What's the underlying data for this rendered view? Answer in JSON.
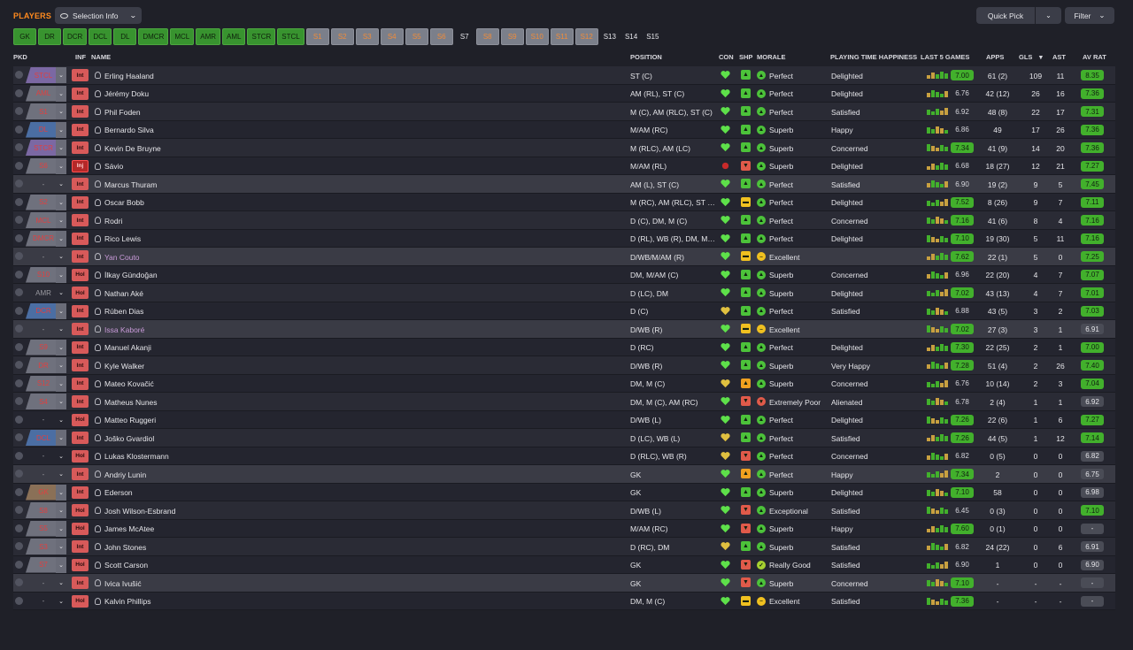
{
  "header": {
    "title": "PLAYERS",
    "selection_info": "Selection Info",
    "quick_pick": "Quick Pick",
    "filter": "Filter"
  },
  "positions": [
    {
      "label": "GK",
      "state": "g"
    },
    {
      "label": "DR",
      "state": "g"
    },
    {
      "label": "DCR",
      "state": "g"
    },
    {
      "label": "DCL",
      "state": "g"
    },
    {
      "label": "DL",
      "state": "g"
    },
    {
      "label": "DMCR",
      "state": "g"
    },
    {
      "label": "MCL",
      "state": "g"
    },
    {
      "label": "AMR",
      "state": "g"
    },
    {
      "label": "AML",
      "state": "g"
    },
    {
      "label": "STCR",
      "state": "g"
    },
    {
      "label": "STCL",
      "state": "g"
    },
    {
      "label": "S1",
      "state": "x"
    },
    {
      "label": "S2",
      "state": "x"
    },
    {
      "label": "S3",
      "state": "x"
    },
    {
      "label": "S4",
      "state": "x"
    },
    {
      "label": "S5",
      "state": "x"
    },
    {
      "label": "S6",
      "state": "x"
    },
    {
      "label": "S7",
      "state": "n"
    },
    {
      "label": "S8",
      "state": "x"
    },
    {
      "label": "S9",
      "state": "x"
    },
    {
      "label": "S10",
      "state": "x"
    },
    {
      "label": "S11",
      "state": "x"
    },
    {
      "label": "S12",
      "state": "x"
    },
    {
      "label": "S13",
      "state": "n"
    },
    {
      "label": "S14",
      "state": "n"
    },
    {
      "label": "S15",
      "state": "n"
    }
  ],
  "columns": {
    "pkd": "PKD",
    "inf": "INF",
    "name": "NAME",
    "position": "POSITION",
    "con": "CON",
    "shp": "SHP",
    "morale": "MORALE",
    "pth": "PLAYING TIME HAPPINESS",
    "last5": "LAST 5 GAMES",
    "apps": "APPS",
    "gls": "GLS",
    "ast": "AST",
    "avrat": "AV RAT"
  },
  "colors": {
    "accent": "#ff8a1e",
    "green": "#42b02c",
    "red": "#d85a5a",
    "background": "#1f2028"
  },
  "players": [
    {
      "pkd": "STCL",
      "pc": "pu",
      "inf": "Int",
      "name": "Erling Haaland",
      "position": "ST (C)",
      "shp": "up",
      "morale": "Perfect",
      "pth": "Delighted",
      "l5": "7.00",
      "l5hi": true,
      "apps": "61 (2)",
      "gls": "109",
      "ast": "11",
      "av": "8.35",
      "avhi": true
    },
    {
      "pkd": "AML",
      "pc": "g",
      "inf": "Int",
      "name": "Jérémy Doku",
      "position": "AM (RL), ST (C)",
      "shp": "up",
      "morale": "Perfect",
      "pth": "Delighted",
      "l5": "6.76",
      "l5hi": false,
      "apps": "42 (12)",
      "gls": "26",
      "ast": "16",
      "av": "7.36",
      "avhi": true
    },
    {
      "pkd": "S1",
      "pc": "g",
      "inf": "Int",
      "name": "Phil Foden",
      "position": "M (C), AM (RLC), ST (C)",
      "shp": "up",
      "morale": "Perfect",
      "pth": "Satisfied",
      "l5": "6.92",
      "l5hi": false,
      "apps": "48 (8)",
      "gls": "22",
      "ast": "17",
      "av": "7.31",
      "avhi": true
    },
    {
      "pkd": "DL",
      "pc": "b",
      "inf": "Int",
      "name": "Bernardo Silva",
      "position": "M/AM (RC)",
      "shp": "up",
      "morale": "Superb",
      "pth": "Happy",
      "l5": "6.86",
      "l5hi": false,
      "apps": "49",
      "gls": "17",
      "ast": "26",
      "av": "7.36",
      "avhi": true
    },
    {
      "pkd": "STCR",
      "pc": "pu",
      "inf": "Int",
      "name": "Kevin De Bruyne",
      "position": "M (RLC), AM (LC)",
      "shp": "up",
      "morale": "Superb",
      "pth": "Concerned",
      "l5": "7.34",
      "l5hi": true,
      "apps": "41 (9)",
      "gls": "14",
      "ast": "20",
      "av": "7.36",
      "avhi": true
    },
    {
      "pkd": "S6",
      "pc": "g",
      "inf": "Inj",
      "name": "Sávio",
      "position": "M/AM (RL)",
      "shp": "down",
      "morale": "Superb",
      "pth": "Delighted",
      "l5": "6.68",
      "l5hi": false,
      "apps": "18 (27)",
      "gls": "12",
      "ast": "21",
      "av": "7.27",
      "avhi": true
    },
    {
      "pkd": "-",
      "pc": "d",
      "inf": "Int",
      "name": "Marcus Thuram",
      "position": "AM (L), ST (C)",
      "shp": "up",
      "morale": "Perfect",
      "pth": "Satisfied",
      "l5": "6.90",
      "l5hi": false,
      "apps": "19 (2)",
      "gls": "9",
      "ast": "5",
      "av": "7.45",
      "avhi": true,
      "hl": true
    },
    {
      "pkd": "S2",
      "pc": "g",
      "inf": "Int",
      "name": "Oscar Bobb",
      "position": "M (RC), AM (RLC), ST (C)",
      "shp": "flat",
      "morale": "Perfect",
      "pth": "Delighted",
      "l5": "7.52",
      "l5hi": true,
      "apps": "8 (26)",
      "gls": "9",
      "ast": "7",
      "av": "7.11",
      "avhi": true
    },
    {
      "pkd": "MCL",
      "pc": "g",
      "inf": "Int",
      "name": "Rodri",
      "position": "D (C), DM, M (C)",
      "shp": "up",
      "morale": "Perfect",
      "pth": "Concerned",
      "l5": "7.16",
      "l5hi": true,
      "apps": "41 (6)",
      "gls": "8",
      "ast": "4",
      "av": "7.16",
      "avhi": true
    },
    {
      "pkd": "DMCR",
      "pc": "g",
      "inf": "Int",
      "name": "Rico Lewis",
      "position": "D (RL), WB (R), DM, M (C)",
      "shp": "up",
      "morale": "Perfect",
      "pth": "Delighted",
      "l5": "7.10",
      "l5hi": true,
      "apps": "19 (30)",
      "gls": "5",
      "ast": "11",
      "av": "7.16",
      "avhi": true
    },
    {
      "pkd": "-",
      "pc": "d",
      "inf": "Int",
      "name": "Yan Couto",
      "loan": true,
      "position": "D/WB/M/AM (R)",
      "shp": "flat",
      "morale": "Excellent",
      "pth": "",
      "l5": "7.62",
      "l5hi": true,
      "apps": "22 (1)",
      "gls": "5",
      "ast": "0",
      "av": "7.25",
      "avhi": true,
      "hl": true
    },
    {
      "pkd": "S10",
      "pc": "g",
      "inf": "Hol",
      "name": "İlkay Gündoğan",
      "position": "DM, M/AM (C)",
      "shp": "up",
      "morale": "Superb",
      "pth": "Concerned",
      "l5": "6.96",
      "l5hi": false,
      "apps": "22 (20)",
      "gls": "4",
      "ast": "7",
      "av": "7.07",
      "avhi": true
    },
    {
      "pkd": "AMR",
      "pc": "d",
      "inf": "Hol",
      "name": "Nathan Aké",
      "position": "D (LC), DM",
      "shp": "up",
      "morale": "Superb",
      "pth": "Delighted",
      "l5": "7.02",
      "l5hi": true,
      "apps": "43 (13)",
      "gls": "4",
      "ast": "7",
      "av": "7.01",
      "avhi": true
    },
    {
      "pkd": "DCR",
      "pc": "b",
      "inf": "Int",
      "name": "Rúben Dias",
      "position": "D (C)",
      "shp": "up",
      "morale": "Perfect",
      "pth": "Satisfied",
      "l5": "6.88",
      "l5hi": false,
      "apps": "43 (5)",
      "gls": "3",
      "ast": "2",
      "av": "7.03",
      "avhi": true
    },
    {
      "pkd": "-",
      "pc": "d",
      "inf": "Int",
      "name": "Issa Kaboré",
      "loan": true,
      "position": "D/WB (R)",
      "shp": "flat",
      "morale": "Excellent",
      "pth": "",
      "l5": "7.02",
      "l5hi": true,
      "apps": "27 (3)",
      "gls": "3",
      "ast": "1",
      "av": "6.91",
      "avhi": false,
      "hl": true
    },
    {
      "pkd": "S9",
      "pc": "g",
      "inf": "Int",
      "name": "Manuel Akanji",
      "position": "D (RC)",
      "shp": "up",
      "morale": "Perfect",
      "pth": "Delighted",
      "l5": "7.30",
      "l5hi": true,
      "apps": "22 (25)",
      "gls": "2",
      "ast": "1",
      "av": "7.00",
      "avhi": true
    },
    {
      "pkd": "DR",
      "pc": "g",
      "inf": "Int",
      "name": "Kyle Walker",
      "position": "D/WB (R)",
      "shp": "up",
      "morale": "Superb",
      "pth": "Very Happy",
      "l5": "7.28",
      "l5hi": true,
      "apps": "51 (4)",
      "gls": "2",
      "ast": "26",
      "av": "7.40",
      "avhi": true
    },
    {
      "pkd": "S12",
      "pc": "g",
      "inf": "Int",
      "name": "Mateo Kovačić",
      "position": "DM, M (C)",
      "shp": "upo",
      "morale": "Superb",
      "pth": "Concerned",
      "l5": "6.76",
      "l5hi": false,
      "apps": "10 (14)",
      "gls": "2",
      "ast": "3",
      "av": "7.04",
      "avhi": true
    },
    {
      "pkd": "S4",
      "pc": "g",
      "inf": "Int",
      "name": "Matheus Nunes",
      "position": "DM, M (C), AM (RC)",
      "shp": "down",
      "morale": "Extremely Poor",
      "pth": "Alienated",
      "l5": "6.78",
      "l5hi": false,
      "apps": "2 (4)",
      "gls": "1",
      "ast": "1",
      "av": "6.92",
      "avhi": false
    },
    {
      "pkd": "-",
      "pc": "d",
      "inf": "Hol",
      "name": "Matteo Ruggeri",
      "position": "D/WB (L)",
      "shp": "up",
      "morale": "Perfect",
      "pth": "Delighted",
      "l5": "7.26",
      "l5hi": true,
      "apps": "22 (6)",
      "gls": "1",
      "ast": "6",
      "av": "7.27",
      "avhi": true
    },
    {
      "pkd": "DCL",
      "pc": "b",
      "inf": "Int",
      "name": "Joško Gvardiol",
      "position": "D (LC), WB (L)",
      "shp": "up",
      "morale": "Perfect",
      "pth": "Satisfied",
      "l5": "7.26",
      "l5hi": true,
      "apps": "44 (5)",
      "gls": "1",
      "ast": "12",
      "av": "7.14",
      "avhi": true
    },
    {
      "pkd": "-",
      "pc": "d",
      "inf": "Hol",
      "name": "Lukas Klostermann",
      "position": "D (RLC), WB (R)",
      "shp": "down",
      "morale": "Perfect",
      "pth": "Concerned",
      "l5": "6.82",
      "l5hi": false,
      "apps": "0 (5)",
      "gls": "0",
      "ast": "0",
      "av": "6.82",
      "avhi": false
    },
    {
      "pkd": "-",
      "pc": "d",
      "inf": "Int",
      "name": "Andriy Lunin",
      "position": "GK",
      "shp": "upo",
      "morale": "Perfect",
      "pth": "Happy",
      "l5": "7.34",
      "l5hi": true,
      "apps": "2",
      "gls": "0",
      "ast": "0",
      "av": "6.75",
      "avhi": false,
      "hl": true
    },
    {
      "pkd": "GK",
      "pc": "br",
      "inf": "Int",
      "name": "Ederson",
      "position": "GK",
      "shp": "up",
      "morale": "Superb",
      "pth": "Delighted",
      "l5": "7.10",
      "l5hi": true,
      "apps": "58",
      "gls": "0",
      "ast": "0",
      "av": "6.98",
      "avhi": false
    },
    {
      "pkd": "S8",
      "pc": "g",
      "inf": "Hol",
      "name": "Josh Wilson-Esbrand",
      "position": "D/WB (L)",
      "shp": "down",
      "morale": "Exceptional",
      "pth": "Satisfied",
      "l5": "6.45",
      "l5hi": false,
      "apps": "0 (3)",
      "gls": "0",
      "ast": "0",
      "av": "7.10",
      "avhi": true
    },
    {
      "pkd": "S5",
      "pc": "g",
      "inf": "Hol",
      "name": "James McAtee",
      "position": "M/AM (RC)",
      "shp": "down",
      "morale": "Superb",
      "pth": "Happy",
      "l5": "7.60",
      "l5hi": true,
      "apps": "0 (1)",
      "gls": "0",
      "ast": "0",
      "av": "-",
      "avhi": false
    },
    {
      "pkd": "S3",
      "pc": "g",
      "inf": "Int",
      "name": "John Stones",
      "position": "D (RC), DM",
      "shp": "up",
      "morale": "Superb",
      "pth": "Satisfied",
      "l5": "6.82",
      "l5hi": false,
      "apps": "24 (22)",
      "gls": "0",
      "ast": "6",
      "av": "6.91",
      "avhi": false
    },
    {
      "pkd": "S7",
      "pc": "g",
      "inf": "Hol",
      "name": "Scott Carson",
      "position": "GK",
      "shp": "down",
      "morale": "Really Good",
      "pth": "Satisfied",
      "l5": "6.90",
      "l5hi": false,
      "apps": "1",
      "gls": "0",
      "ast": "0",
      "av": "6.90",
      "avhi": false
    },
    {
      "pkd": "-",
      "pc": "d",
      "inf": "Int",
      "name": "Ivica Ivušić",
      "position": "GK",
      "shp": "down",
      "morale": "Superb",
      "pth": "Concerned",
      "l5": "7.10",
      "l5hi": true,
      "apps": "-",
      "gls": "-",
      "ast": "-",
      "av": "-",
      "avhi": false,
      "hl": true
    },
    {
      "pkd": "-",
      "pc": "d",
      "inf": "Hol",
      "name": "Kalvin Phillips",
      "position": "DM, M (C)",
      "shp": "flat",
      "morale": "Excellent",
      "pth": "Satisfied",
      "l5": "7.36",
      "l5hi": true,
      "apps": "-",
      "gls": "-",
      "ast": "-",
      "av": "-",
      "avhi": false
    }
  ]
}
